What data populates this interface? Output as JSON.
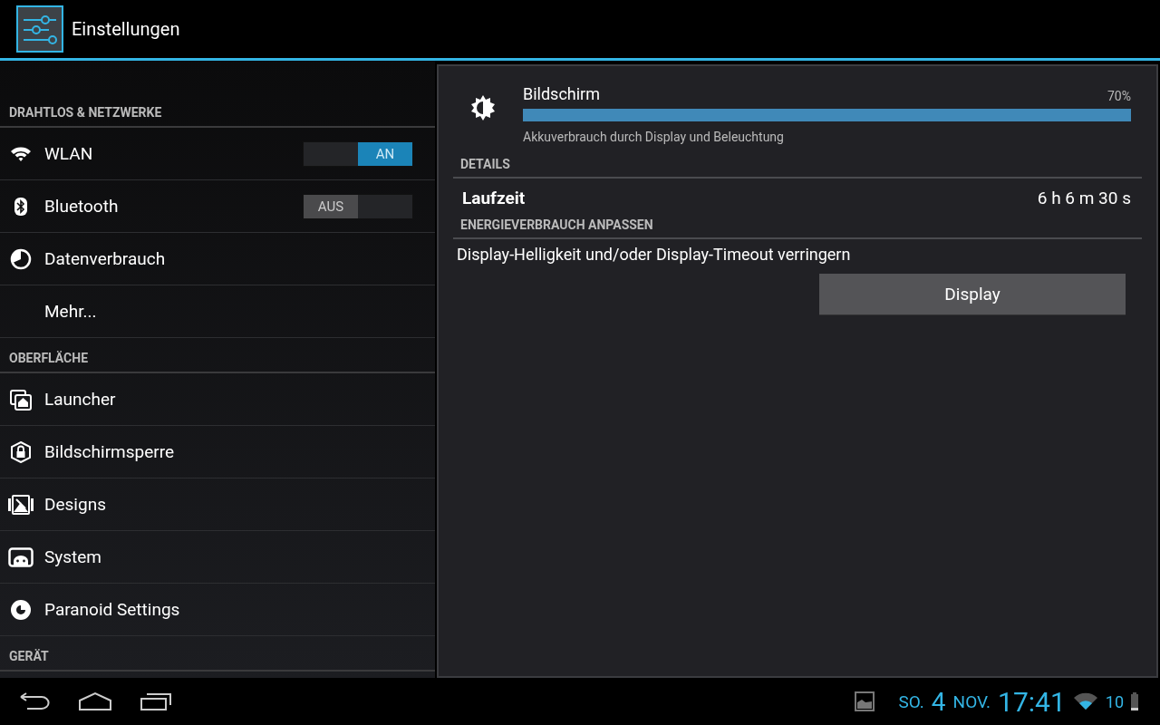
{
  "app_bar": {
    "title": "Einstellungen"
  },
  "sidebar": {
    "sections": [
      {
        "header": "DRAHTLOS & NETZWERKE",
        "items": [
          {
            "label": "WLAN",
            "kind": "toggle",
            "on": true,
            "switch_text": "AN"
          },
          {
            "label": "Bluetooth",
            "kind": "toggle",
            "on": false,
            "switch_text": "AUS"
          },
          {
            "label": "Datenverbrauch",
            "kind": "plain"
          },
          {
            "label": "Mehr...",
            "kind": "plain"
          }
        ]
      },
      {
        "header": "OBERFLÄCHE",
        "items": [
          {
            "label": "Launcher",
            "kind": "plain"
          },
          {
            "label": "Bildschirmsperre",
            "kind": "plain"
          },
          {
            "label": "Designs",
            "kind": "plain"
          },
          {
            "label": "System",
            "kind": "plain"
          },
          {
            "label": "Paranoid Settings",
            "kind": "plain"
          }
        ]
      },
      {
        "header": "GERÄT"
      }
    ]
  },
  "detail": {
    "usage": {
      "title": "Bildschirm",
      "percent": "70%",
      "level": 1,
      "subtitle": "Akkuverbrauch durch Display und Beleuchtung"
    },
    "details_header": "DETAILS",
    "runtime": {
      "label": "Laufzeit",
      "value": "6 h 6 m 30 s"
    },
    "adjust_header": "ENERGIEVERBRAUCH ANPASSEN",
    "hint": "Display-Helligkeit und/oder Display-Timeout verringern",
    "button": "Display"
  },
  "status_bar": {
    "weekday": "SO.",
    "day": "4",
    "month": "NOV.",
    "time": "17:41",
    "battery": "10"
  }
}
